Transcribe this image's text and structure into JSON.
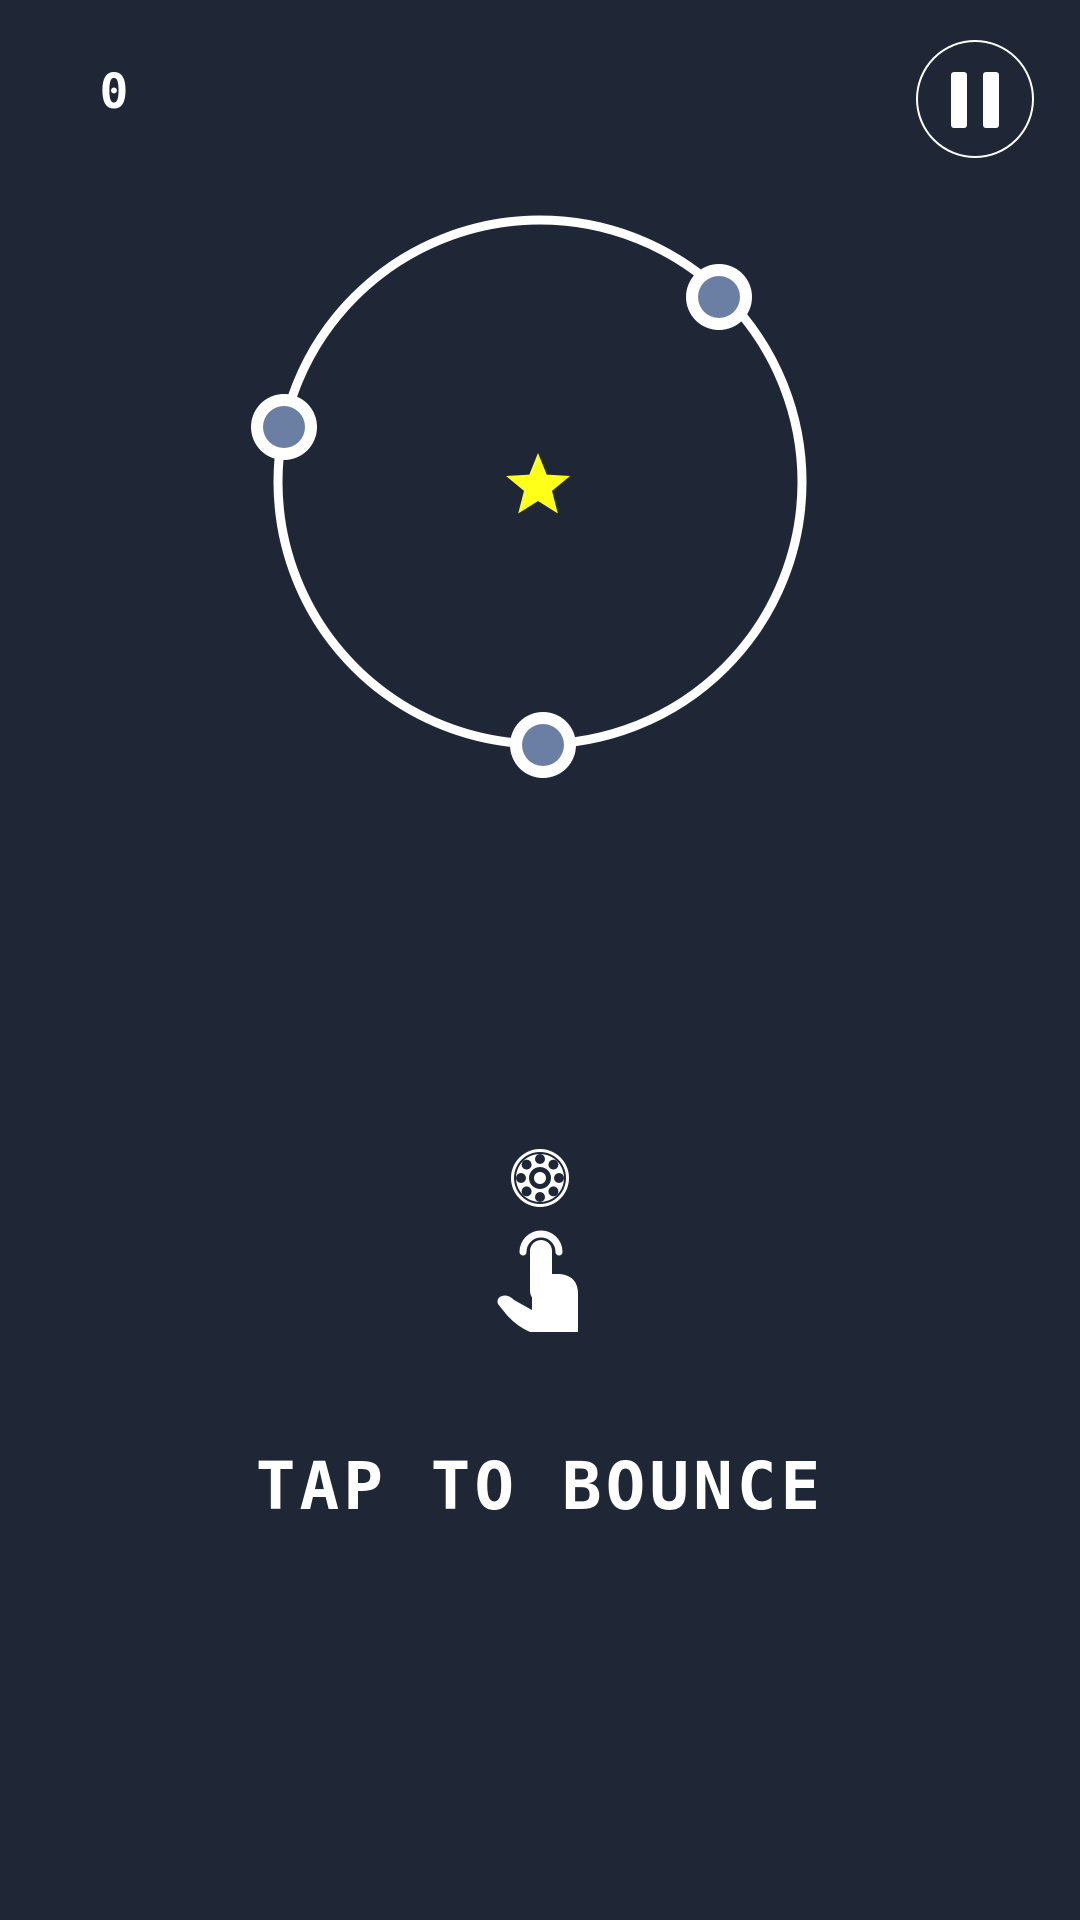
{
  "hud": {
    "score": "0",
    "pause_icon": "pause-icon"
  },
  "game": {
    "ring_color": "#ffffff",
    "node_fill_color": "#6a7fa3",
    "star_color": "#ffff1a",
    "background_color": "#1f2736",
    "center_item_icon": "star-icon",
    "player_icon": "ball-icon"
  },
  "tutorial": {
    "hand_icon": "tap-hand-icon",
    "text": "TAP TO BOUNCE"
  }
}
